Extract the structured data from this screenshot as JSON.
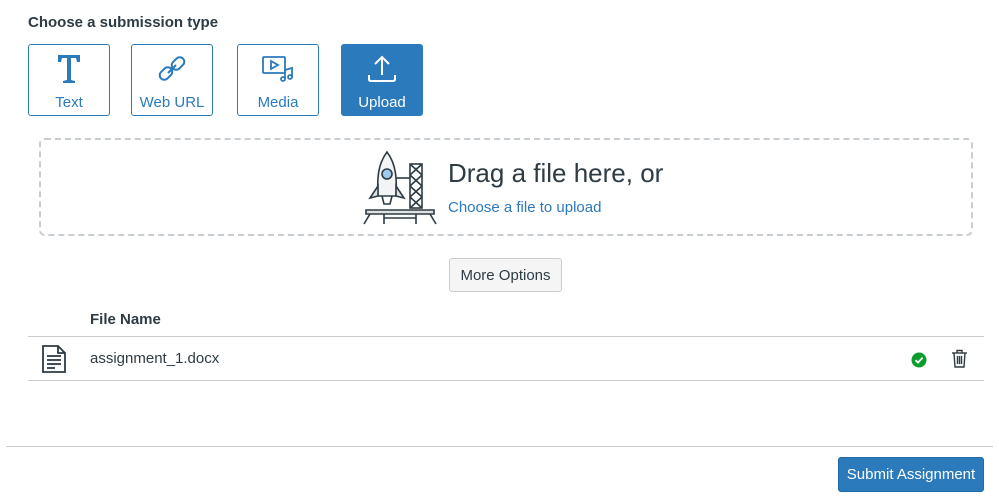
{
  "heading": "Choose a submission type",
  "submission_types": [
    {
      "label": "Text",
      "icon": "text-icon",
      "selected": false
    },
    {
      "label": "Web URL",
      "icon": "link-icon",
      "selected": false
    },
    {
      "label": "Media",
      "icon": "media-icon",
      "selected": false
    },
    {
      "label": "Upload",
      "icon": "upload-icon",
      "selected": true
    }
  ],
  "dropzone": {
    "title": "Drag a file here, or",
    "link": "Choose a file to upload",
    "illustration": "rocket-launch-icon"
  },
  "more_options_label": "More Options",
  "files": {
    "header": "File Name",
    "items": [
      {
        "name": "assignment_1.docx",
        "icon": "document-icon",
        "status": "complete-check-icon"
      }
    ]
  },
  "submit_label": "Submit Assignment",
  "colors": {
    "accent": "#2b7abc",
    "success": "#0b9d2b",
    "text": "#2d3b45",
    "border": "#c7cdd1"
  }
}
